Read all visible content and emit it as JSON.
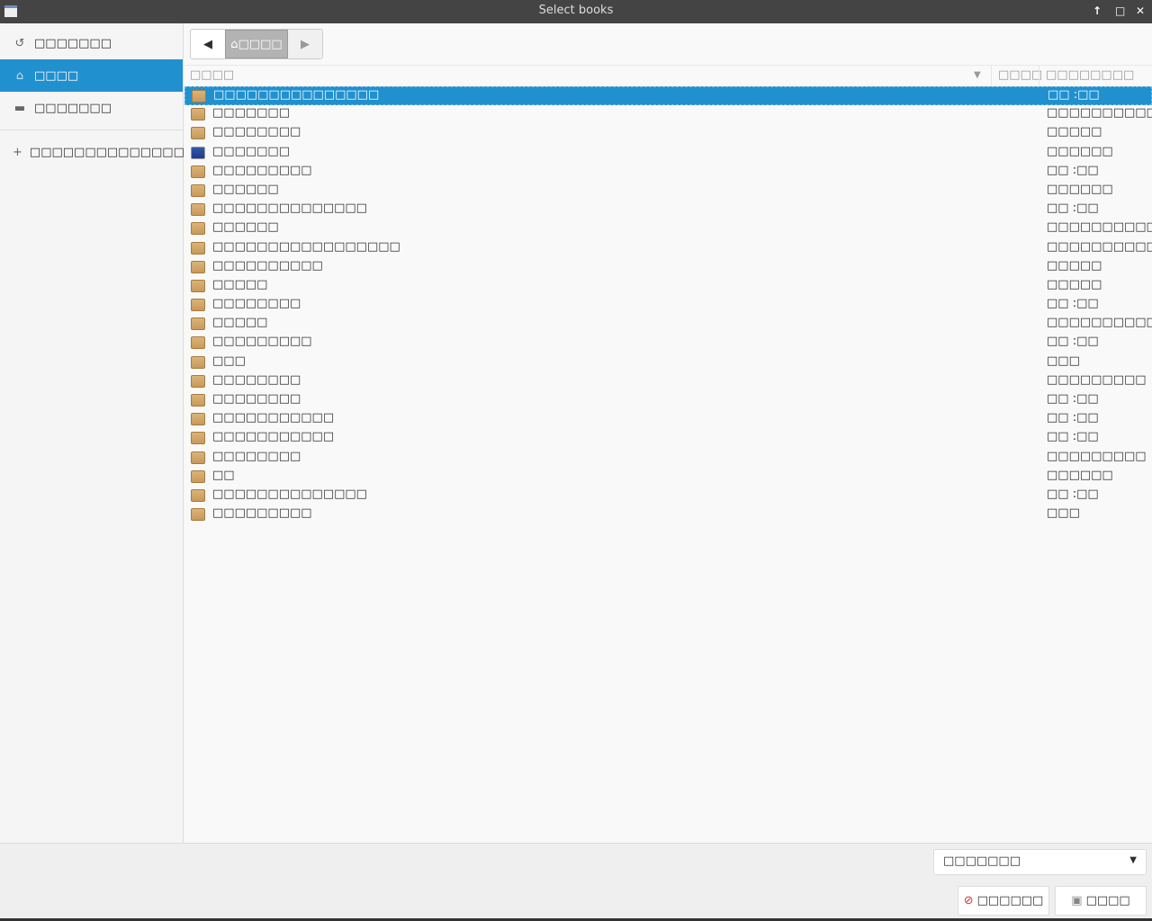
{
  "window": {
    "title": "Select books"
  },
  "sidebar": {
    "items": [
      {
        "label": "□□□□□□□",
        "icon": "history-icon"
      },
      {
        "label": "□□□□",
        "icon": "home-icon",
        "selected": true
      },
      {
        "label": "□□□□□□□",
        "icon": "folder-icon"
      },
      {
        "label": "□□□□□□□□□□□□□□□",
        "icon": "plus-icon"
      }
    ]
  },
  "pathbar": {
    "home": "□□□□"
  },
  "columns": {
    "name": "□□□□",
    "size": "□□□□",
    "modified": "□□□□□□□□"
  },
  "files": [
    {
      "name": "□□□□□□□□□□□□□□□",
      "modified": "□□ :□□",
      "selected": true
    },
    {
      "name": "□□□□□□□",
      "modified": "□□□□□□□□□□□"
    },
    {
      "name": "□□□□□□□□",
      "modified": "□□□□□"
    },
    {
      "name": "□□□□□□□",
      "modified": "□□□□□□",
      "icon": "image-file"
    },
    {
      "name": "□□□□□□□□□",
      "modified": "□□ :□□"
    },
    {
      "name": "□□□□□□",
      "modified": "□□□□□□"
    },
    {
      "name": "□□□□□□□□□□□□□□",
      "modified": "□□ :□□"
    },
    {
      "name": "□□□□□□",
      "modified": "□□□□□□□□□□□"
    },
    {
      "name": "□□□□□□□□□□□□□□□□□",
      "modified": "□□□□□□□□□□□"
    },
    {
      "name": "□□□□□□□□□□",
      "modified": "□□□□□"
    },
    {
      "name": "□□□□□",
      "modified": "□□□□□"
    },
    {
      "name": "□□□□□□□□",
      "modified": "□□ :□□"
    },
    {
      "name": "□□□□□",
      "modified": "□□□□□□□□□□□"
    },
    {
      "name": "□□□□□□□□□",
      "modified": "□□ :□□"
    },
    {
      "name": "□□□",
      "modified": "□□□"
    },
    {
      "name": "□□□□□□□□",
      "modified": "□□□□□□□□□"
    },
    {
      "name": "□□□□□□□□",
      "modified": "□□ :□□"
    },
    {
      "name": "□□□□□□□□□□□",
      "modified": "□□ :□□"
    },
    {
      "name": "□□□□□□□□□□□",
      "modified": "□□ :□□"
    },
    {
      "name": "□□□□□□□□",
      "modified": "□□□□□□□□□"
    },
    {
      "name": "□□",
      "modified": "□□□□□□"
    },
    {
      "name": "□□□□□□□□□□□□□□",
      "modified": "□□ :□□"
    },
    {
      "name": "□□□□□□□□□",
      "modified": "□□□"
    }
  ],
  "filter": {
    "value": "□□□□□□□"
  },
  "buttons": {
    "cancel": "□□□□□□",
    "open": "□□□□"
  },
  "colors": {
    "accent": "#2190cf",
    "titlebar": "#444444"
  }
}
